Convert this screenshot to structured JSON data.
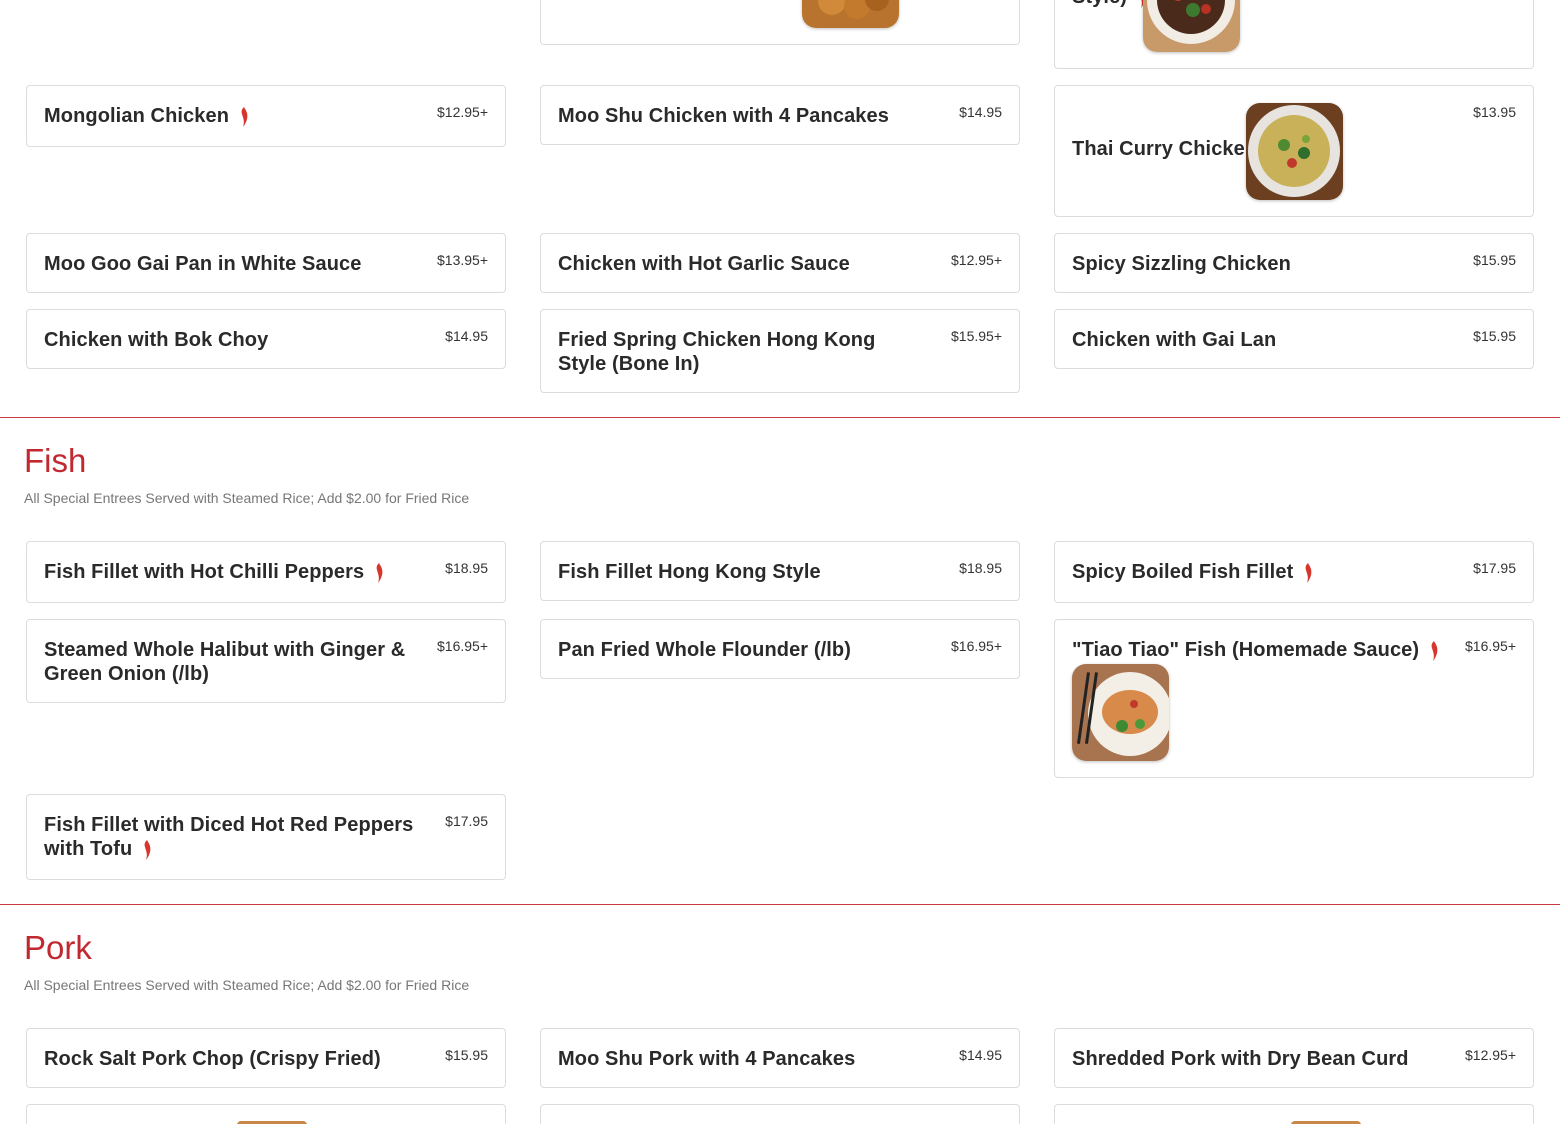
{
  "top_partial": {
    "right_card_fragment": "Style)"
  },
  "chicken": {
    "items": [
      {
        "name": "Mongolian Chicken",
        "price": "$12.95+"
      },
      {
        "name": "Moo Shu Chicken with 4 Pancakes",
        "price": "$14.95"
      },
      {
        "name": "Thai Curry Chicken",
        "price": "$13.95"
      },
      {
        "name": "Moo Goo Gai Pan in White Sauce",
        "price": "$13.95+"
      },
      {
        "name": "Chicken with Hot Garlic Sauce",
        "price": "$12.95+"
      },
      {
        "name": "Spicy Sizzling Chicken",
        "price": "$15.95"
      },
      {
        "name": "Chicken with Bok Choy",
        "price": "$14.95"
      },
      {
        "name": "Fried Spring Chicken Hong Kong Style (Bone In)",
        "price": "$15.95+"
      },
      {
        "name": "Chicken with Gai Lan",
        "price": "$15.95"
      }
    ]
  },
  "fish": {
    "title": "Fish",
    "subtitle": "All Special Entrees Served with Steamed Rice; Add $2.00 for Fried Rice",
    "items": [
      {
        "name": "Fish Fillet with Hot Chilli Peppers",
        "price": "$18.95"
      },
      {
        "name": "Fish Fillet Hong Kong Style",
        "price": "$18.95"
      },
      {
        "name": "Spicy Boiled Fish Fillet",
        "price": "$17.95"
      },
      {
        "name": "Steamed Whole Halibut with Ginger & Green Onion (/lb)",
        "price": "$16.95+"
      },
      {
        "name": "Pan Fried Whole Flounder (/lb)",
        "price": "$16.95+"
      },
      {
        "name": "\"Tiao Tiao\" Fish (Homemade Sauce)",
        "price": "$16.95+"
      },
      {
        "name": "Fish Fillet with Diced Hot Red Peppers with Tofu",
        "price": "$17.95"
      }
    ]
  },
  "pork": {
    "title": "Pork",
    "subtitle": "All Special Entrees Served with Steamed Rice; Add $2.00 for Fried Rice",
    "items": [
      {
        "name": "Rock Salt Pork Chop (Crispy Fried)",
        "price": "$15.95"
      },
      {
        "name": "Moo Shu Pork with 4 Pancakes",
        "price": "$14.95"
      },
      {
        "name": "Shredded Pork with Dry Bean Curd",
        "price": "$12.95+"
      }
    ]
  },
  "icons": {
    "spicy": "chili-pepper-icon"
  },
  "colors": {
    "accent": "#c1282f",
    "divider": "#c9393f",
    "chili": "#d6362b"
  }
}
